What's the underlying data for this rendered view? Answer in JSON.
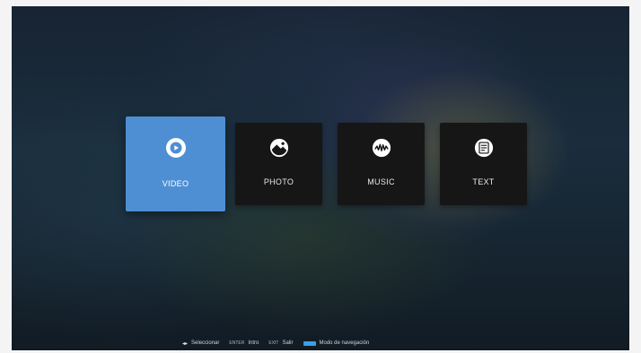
{
  "menu": {
    "items": [
      {
        "label": "VIDEO",
        "icon": "video-icon",
        "selected": true
      },
      {
        "label": "PHOTO",
        "icon": "photo-icon",
        "selected": false
      },
      {
        "label": "MUSIC",
        "icon": "music-icon",
        "selected": false
      },
      {
        "label": "TEXT",
        "icon": "text-icon",
        "selected": false
      }
    ]
  },
  "hints": {
    "select_key": "◂▸",
    "select": "Seleccionar",
    "enter_key": "ENTER",
    "enter": "Intro",
    "exit_key": "EXIT",
    "exit": "Salir",
    "nav_mode": "Modo de navegación"
  },
  "colors": {
    "selected_tile": "#4e8fd4",
    "tile": "#161617",
    "nav_key": "#3aa0e8"
  }
}
